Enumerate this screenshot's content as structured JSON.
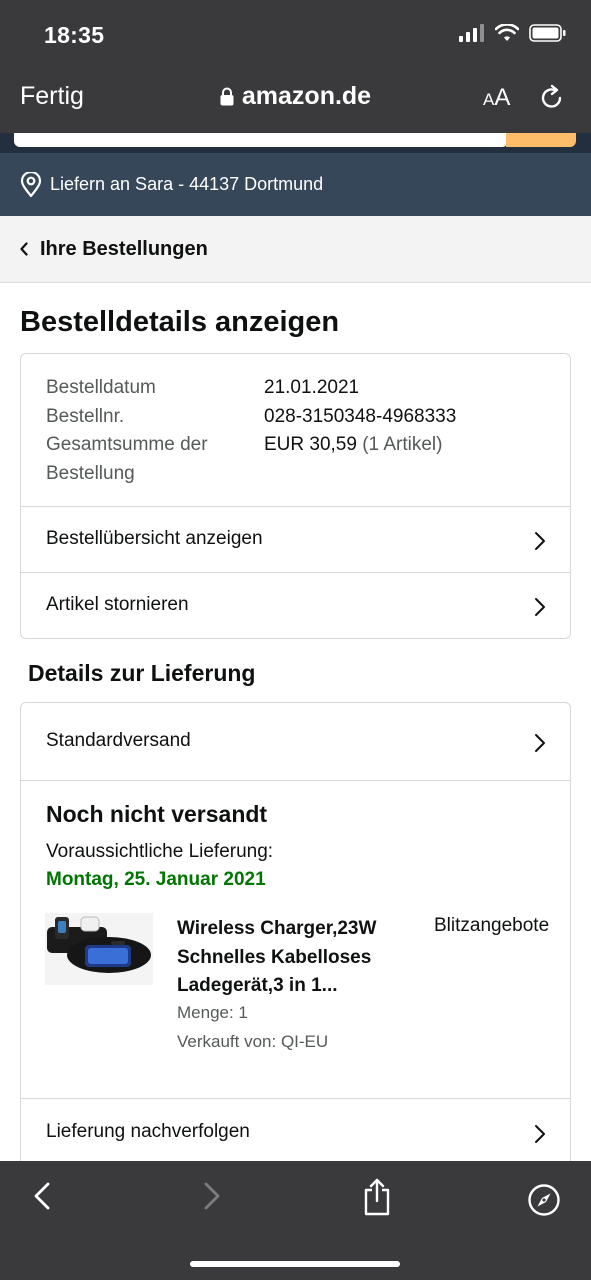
{
  "status_bar": {
    "time": "18:35"
  },
  "browser": {
    "done_label": "Fertig",
    "url": "amazon.de",
    "text_size_label_small": "A",
    "text_size_label_large": "A"
  },
  "delivery_location": {
    "text": "Liefern an Sara - 44137 Dortmund"
  },
  "back_link": {
    "label": "Ihre Bestellungen"
  },
  "page_title": "Bestelldetails anzeigen",
  "order_info": {
    "date_label": "Bestelldatum",
    "date_value": "21.01.2021",
    "number_label": "Bestellnr.",
    "number_value": "028-3150348-4968333",
    "total_label": "Gesamtsumme der Bestellung",
    "total_value": "EUR 30,59",
    "total_items": "(1 Artikel)"
  },
  "order_actions": [
    {
      "label": "Bestellübersicht anzeigen"
    },
    {
      "label": "Artikel stornieren"
    }
  ],
  "delivery_section": {
    "title": "Details zur Lieferung",
    "shipping_method": "Standardversand",
    "status": "Noch nicht versandt",
    "eta_label": "Voraussichtliche Lieferung:",
    "eta_date": "Montag, 25. Januar 2021",
    "track_label": "Lieferung nachverfolgen"
  },
  "product": {
    "title": "Wireless Charger,23W Schnelles Kabelloses Ladegerät,3 in 1...",
    "quantity": "Menge: 1",
    "seller": "Verkauft von: QI-EU",
    "badge": "Blitzangebote"
  },
  "colors": {
    "chrome": "#3a3a3c",
    "amazon_dark": "#232f3e",
    "amazon_deliver": "#37475a",
    "search_button": "#febd69",
    "eta_green": "#007600"
  }
}
